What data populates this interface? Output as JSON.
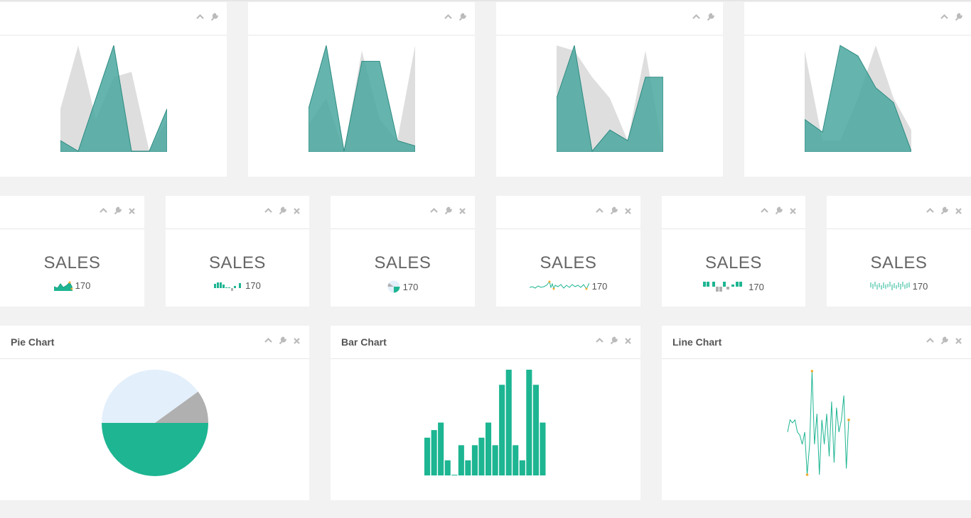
{
  "colors": {
    "accent": "#1db592",
    "teal": "#4aa8a0",
    "teal_dark": "#2e8b82",
    "grey": "#d6d6d6",
    "light_blue": "#e3effb",
    "mid_grey": "#b0b0b0",
    "orange": "#f0ad2e"
  },
  "icons": [
    "chevron-up-icon",
    "wrench-icon",
    "close-icon"
  ],
  "area_charts": [
    {
      "grey": [
        4,
        10,
        3,
        7,
        7.5,
        0,
        3
      ],
      "teal": [
        1,
        0,
        5,
        10,
        0,
        0,
        4
      ]
    },
    {
      "grey": [
        2.5,
        5,
        0,
        9.5,
        3,
        1,
        10
      ],
      "teal": [
        4,
        10,
        0,
        8.5,
        8.5,
        1,
        0.5
      ]
    },
    {
      "grey": [
        10,
        9.5,
        7,
        5,
        1,
        9.5,
        0
      ],
      "teal": [
        5,
        10,
        0,
        2,
        1,
        7,
        7
      ]
    },
    {
      "grey": [
        9.5,
        1,
        1,
        5,
        10,
        5,
        2
      ],
      "teal": [
        3,
        1.8,
        10,
        9,
        6,
        4.6,
        0
      ]
    }
  ],
  "sales": [
    {
      "label": "SALES",
      "value": "170",
      "spark": "area"
    },
    {
      "label": "SALES",
      "value": "170",
      "spark": "bar"
    },
    {
      "label": "SALES",
      "value": "170",
      "spark": "pie"
    },
    {
      "label": "SALES",
      "value": "170",
      "spark": "line"
    },
    {
      "label": "SALES",
      "value": "170",
      "spark": "tristate"
    },
    {
      "label": "SALES",
      "value": "170",
      "spark": "discrete"
    }
  ],
  "pie": {
    "title": "Pie Chart",
    "chart_data": {
      "type": "pie",
      "values": [
        50,
        40,
        10
      ],
      "colors": [
        "#1db592",
        "#e3effb",
        "#b0b0b0"
      ]
    }
  },
  "bar": {
    "title": "Bar Chart",
    "chart_data": {
      "type": "bar",
      "values": [
        10,
        12,
        14,
        4,
        0,
        8,
        4,
        8,
        10,
        14,
        8,
        24,
        28,
        8,
        4,
        28,
        24,
        14
      ],
      "ylim": [
        0,
        28
      ]
    }
  },
  "line": {
    "title": "Line Chart",
    "chart_data": {
      "type": "line",
      "values": [
        4,
        6,
        5.5,
        6,
        4,
        3.5,
        2,
        4,
        -3,
        2,
        14,
        2,
        7,
        -3,
        6,
        2,
        7,
        0,
        9,
        -1,
        8,
        4,
        6,
        10,
        -2,
        6
      ]
    }
  }
}
